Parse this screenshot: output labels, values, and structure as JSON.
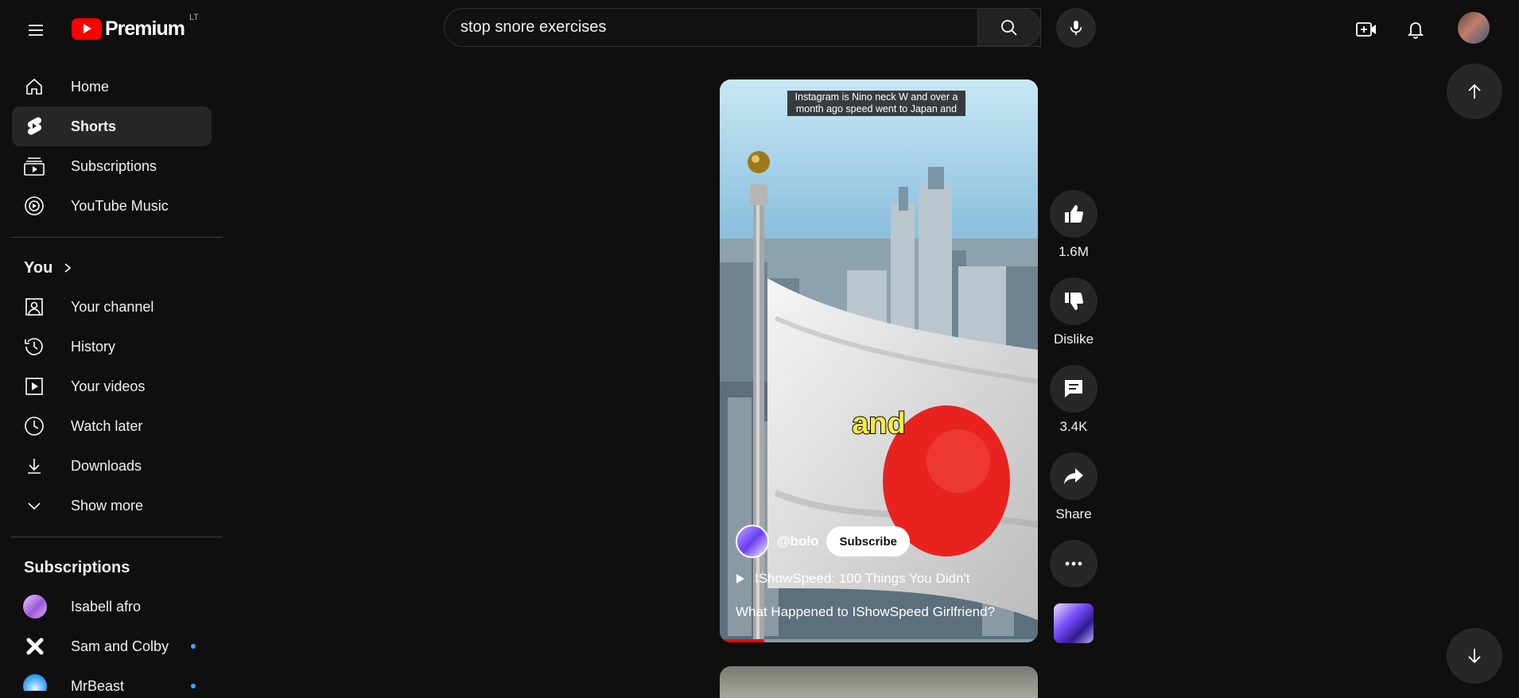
{
  "header": {
    "logo_text": "Premium",
    "country_code": "LT",
    "search_query": "stop snore exercises"
  },
  "sidebar": {
    "main": [
      {
        "label": "Home",
        "icon": "home-icon"
      },
      {
        "label": "Shorts",
        "icon": "shorts-icon",
        "active": true
      },
      {
        "label": "Subscriptions",
        "icon": "subscriptions-icon"
      },
      {
        "label": "YouTube Music",
        "icon": "youtube-music-icon"
      }
    ],
    "you_title": "You",
    "you": [
      {
        "label": "Your channel",
        "icon": "your-channel-icon"
      },
      {
        "label": "History",
        "icon": "history-icon"
      },
      {
        "label": "Your videos",
        "icon": "your-videos-icon"
      },
      {
        "label": "Watch later",
        "icon": "watch-later-icon"
      },
      {
        "label": "Downloads",
        "icon": "download-icon"
      },
      {
        "label": "Show more",
        "icon": "chevron-down-icon"
      }
    ],
    "subscriptions_title": "Subscriptions",
    "subscriptions": [
      {
        "label": "Isabell afro",
        "new": false
      },
      {
        "label": "Sam and Colby",
        "new": true
      },
      {
        "label": "MrBeast",
        "new": true
      }
    ]
  },
  "short": {
    "caption": "Instagram is Nino neck W and over a month ago speed went to Japan and",
    "subtitle_word": "and",
    "channel": "@bolo",
    "subscribe_label": "Subscribe",
    "suggested": "IShowSpeed: 100 Things You Didn't",
    "title": "What Happened to IShowSpeed Girlfriend?",
    "progress_fraction": 0.14
  },
  "actions": {
    "likes": "1.6M",
    "dislike": "Dislike",
    "comments": "3.4K",
    "share": "Share"
  },
  "colors": {
    "background": "#0f0f0f",
    "brand_red": "#ff0000",
    "chip": "#272727",
    "accent_blue": "#3ea6ff"
  }
}
